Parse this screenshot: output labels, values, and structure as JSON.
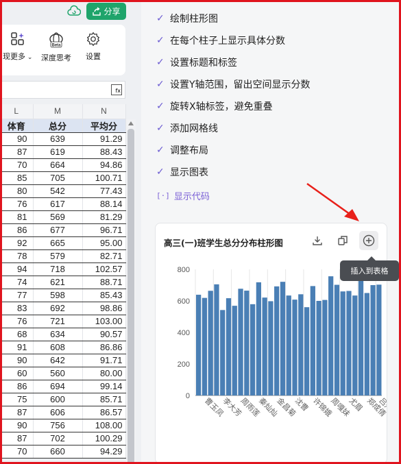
{
  "app": {
    "share_label": "分享",
    "tools": [
      {
        "label": "现更多",
        "icon": "apps-sparkle-icon"
      },
      {
        "label": "深度思考",
        "icon": "beta-brain-icon",
        "badge": "Beta"
      },
      {
        "label": "设置",
        "icon": "gear-icon"
      }
    ],
    "fx_label": "fx"
  },
  "sheet": {
    "column_letters": [
      "L",
      "M",
      "N"
    ],
    "headers": [
      "体育",
      "总分",
      "平均分"
    ],
    "rows": [
      [
        "90",
        "639",
        "91.29"
      ],
      [
        "87",
        "619",
        "88.43"
      ],
      [
        "70",
        "664",
        "94.86"
      ],
      [
        "85",
        "705",
        "100.71"
      ],
      [
        "80",
        "542",
        "77.43"
      ],
      [
        "76",
        "617",
        "88.14"
      ],
      [
        "81",
        "569",
        "81.29"
      ],
      [
        "86",
        "677",
        "96.71"
      ],
      [
        "92",
        "665",
        "95.00"
      ],
      [
        "78",
        "579",
        "82.71"
      ],
      [
        "94",
        "718",
        "102.57"
      ],
      [
        "74",
        "621",
        "88.71"
      ],
      [
        "77",
        "598",
        "85.43"
      ],
      [
        "83",
        "692",
        "98.86"
      ],
      [
        "76",
        "721",
        "103.00"
      ],
      [
        "68",
        "634",
        "90.57"
      ],
      [
        "91",
        "608",
        "86.86"
      ],
      [
        "90",
        "642",
        "91.71"
      ],
      [
        "60",
        "560",
        "80.00"
      ],
      [
        "86",
        "694",
        "99.14"
      ],
      [
        "75",
        "600",
        "85.71"
      ],
      [
        "87",
        "606",
        "86.57"
      ],
      [
        "90",
        "756",
        "108.00"
      ],
      [
        "87",
        "702",
        "100.29"
      ],
      [
        "70",
        "660",
        "94.29"
      ]
    ]
  },
  "steps": [
    "绘制柱形图",
    "在每个柱子上显示具体分数",
    "设置标题和标签",
    "设置Y轴范围，留出空间显示分数",
    "旋转X轴标签，避免重叠",
    "添加网格线",
    "调整布局",
    "显示图表"
  ],
  "show_code_label": "显示代码",
  "card": {
    "title": "高三(一)班学生总分分布柱形图",
    "icons": [
      "download-icon",
      "copy-icon",
      "insert-plus-icon"
    ],
    "tooltip": "插入到表格"
  },
  "colors": {
    "bar": "#4a7fb5",
    "check": "#6b5bd2",
    "share": "#1fa46b",
    "accent": "#7a5fd6"
  },
  "chart_data": {
    "type": "bar",
    "title": "",
    "xlabel": "",
    "ylabel": "",
    "ylim": [
      0,
      800
    ],
    "yticks": [
      0,
      200,
      400,
      600,
      800
    ],
    "grid": "vertical",
    "values": [
      639,
      619,
      664,
      705,
      542,
      617,
      569,
      677,
      665,
      579,
      718,
      621,
      598,
      692,
      721,
      634,
      608,
      642,
      560,
      694,
      600,
      606,
      756,
      702,
      660,
      663,
      634,
      731,
      650,
      700,
      703
    ],
    "xtick_labels": [
      {
        "index": 1,
        "text": "曹玉凤"
      },
      {
        "index": 4,
        "text": "李大芳"
      },
      {
        "index": 7,
        "text": "周雨莲"
      },
      {
        "index": 10,
        "text": "秦灿灿"
      },
      {
        "index": 13,
        "text": "金昌菊"
      },
      {
        "index": 16,
        "text": "沈曹"
      },
      {
        "index": 19,
        "text": "许锦娥"
      },
      {
        "index": 22,
        "text": "周嘎妹"
      },
      {
        "index": 25,
        "text": "尤眉"
      },
      {
        "index": 28,
        "text": "郑成倩"
      },
      {
        "index": 30,
        "text": "吕丹"
      }
    ]
  }
}
